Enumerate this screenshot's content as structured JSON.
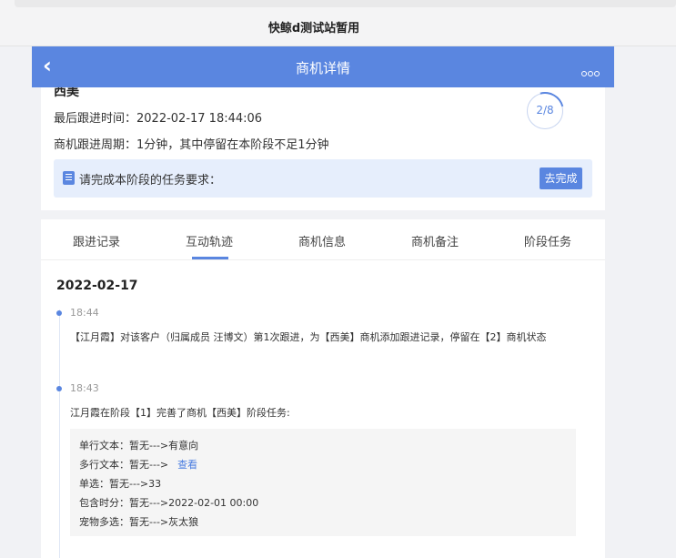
{
  "site": {
    "title": "快鲸d测试站暂用"
  },
  "header": {
    "title": "商机详情",
    "back_icon": "chevron-left-icon",
    "more_icon": "more-dots-icon"
  },
  "summary": {
    "name": "西美",
    "last_follow": "最后跟进时间：2022-02-17 18:44:06",
    "cycle": "商机跟进周期：1分钟，其中停留在本阶段不足1分钟",
    "progress": "2/8",
    "progress_fraction": 0.25,
    "task_prompt": "请完成本阶段的任务要求：",
    "task_button": "去完成"
  },
  "tabs": [
    {
      "label": "跟进记录",
      "active": false
    },
    {
      "label": "互动轨迹",
      "active": true
    },
    {
      "label": "商机信息",
      "active": false
    },
    {
      "label": "商机备注",
      "active": false
    },
    {
      "label": "阶段任务",
      "active": false
    }
  ],
  "timeline": {
    "date": "2022-02-17",
    "entries": [
      {
        "time": "18:44",
        "text": "【江月霞】对该客户（归属成员 汪博文）第1次跟进，为【西美】商机添加跟进记录，停留在【2】商机状态"
      },
      {
        "time": "18:43",
        "text": "江月霞在阶段【1】完善了商机【西美】阶段任务:",
        "details": [
          {
            "text": "单行文本：暂无--->有意向"
          },
          {
            "text": "多行文本：暂无--->",
            "link": "查看"
          },
          {
            "text": "单选：暂无--->33"
          },
          {
            "text": "包含时分：暂无--->2022-02-01 00:00"
          },
          {
            "text": "宠物多选：暂无--->灰太狼"
          }
        ]
      }
    ]
  },
  "colors": {
    "accent": "#5a86e0",
    "task_bg": "#e6eefc"
  }
}
